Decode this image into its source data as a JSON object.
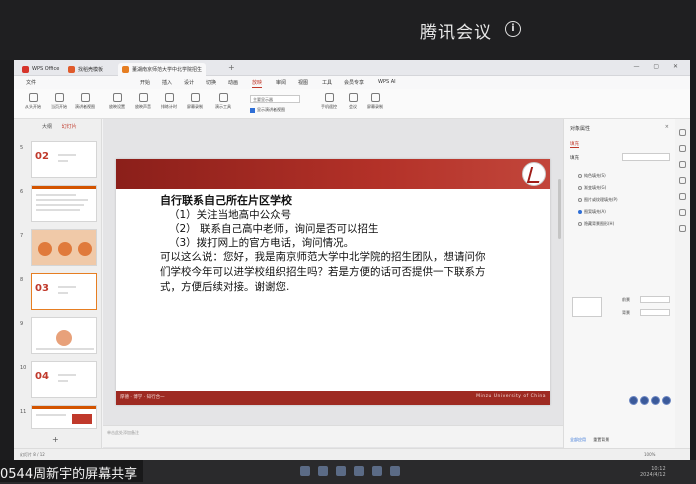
{
  "meeting": {
    "title": "腾讯会议",
    "info_icon": "i",
    "share_label": "0544周新宇的屏幕共享"
  },
  "window": {
    "tabs": [
      "WPS Office",
      "找稻壳模板",
      "董湖南京师范大学中北学院招生"
    ],
    "tab_plus": "+"
  },
  "menu": {
    "items": [
      "文件",
      "开始",
      "插入",
      "设计",
      "切换",
      "动画",
      "放映",
      "审阅",
      "视图",
      "工具",
      "会员专享",
      "WPS AI"
    ],
    "active_index": 6
  },
  "ribbon": {
    "buttons": [
      "从头开始",
      "当页开始",
      "演讲者视图",
      "放映设置",
      "放映声音",
      "排练计时",
      "屏幕录制",
      "演示工具",
      "手机遥控",
      "会议",
      "屏幕录制"
    ],
    "select_value": "主要显示器",
    "check_label": "显示演讲者视图"
  },
  "left_panel": {
    "tabs": [
      "大纲",
      "幻灯片"
    ],
    "selected_tab": 1,
    "slide_numbers": [
      "5",
      "6",
      "7",
      "8",
      "9",
      "10",
      "11"
    ],
    "thumb_numbers": [
      "02",
      "03",
      "04"
    ],
    "add_label": "+"
  },
  "slide": {
    "title": "自行联系自己所在片区学校",
    "lines": [
      "（1）关注当地高中公众号",
      "（2） 联系自己高中老师，询问是否可以招生",
      "（3）拨打网上的官方电话，询问情况。"
    ],
    "paragraph": "可以这么说：您好，我是南京师范大学中北学院的招生团队，想请问你们学校今年可以进学校组织招生吗？若是方便的话可否提供一下联系方式，方便后续对接。谢谢您.",
    "footer_left": "厚德 · 博学 · 知行合一",
    "footer_right": "Minzu University of China"
  },
  "notes": {
    "placeholder": "单击此处添加备注"
  },
  "right_panel": {
    "title": "对象属性",
    "close": "×",
    "tab": "填充",
    "fill_label": "填充",
    "options": [
      "纯色填充(S)",
      "渐变填充(G)",
      "图片或纹理填充(P)",
      "图案填充(A)",
      "隐藏背景图形(H)"
    ],
    "selected_option": 3,
    "fg_label": "前景",
    "bg_label": "背景",
    "footer_buttons": [
      "全部应用",
      "重置背景"
    ]
  },
  "statusbar": {
    "left": "幻灯片 8 / 12",
    "right": "100%"
  },
  "clock": {
    "time": "10:12",
    "date": "2024/4/12"
  }
}
